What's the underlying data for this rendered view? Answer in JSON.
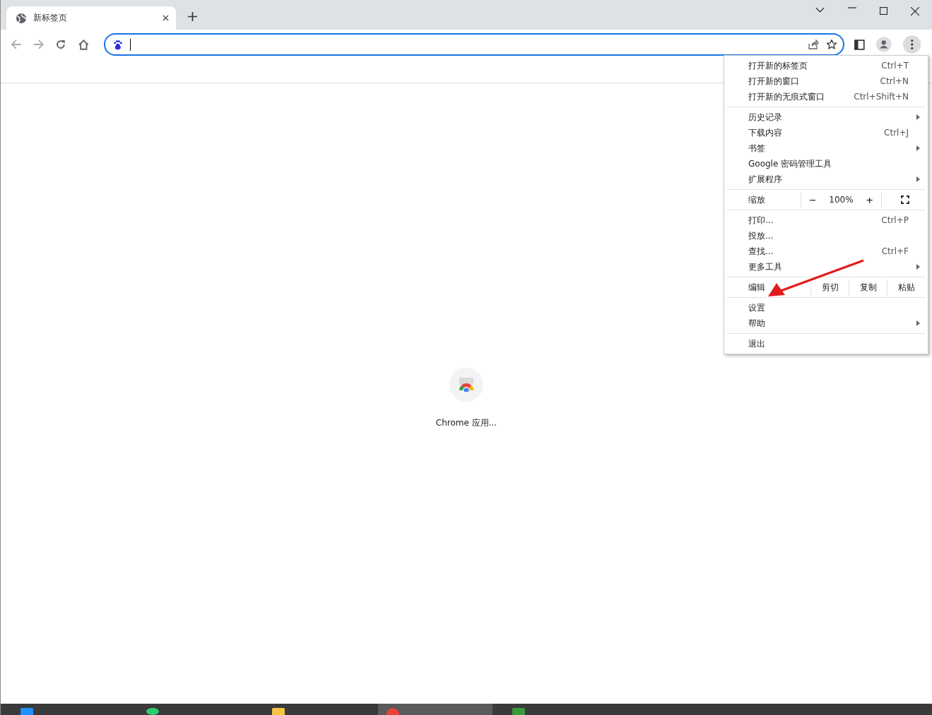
{
  "tabs": [
    {
      "title": "新标签页",
      "selected": true
    }
  ],
  "menu": {
    "items": [
      {
        "kind": "item",
        "label": "打开新的标签页",
        "shortcut": "Ctrl+T",
        "submenu": false
      },
      {
        "kind": "item",
        "label": "打开新的窗口",
        "shortcut": "Ctrl+N",
        "submenu": false
      },
      {
        "kind": "item",
        "label": "打开新的无痕式窗口",
        "shortcut": "Ctrl+Shift+N",
        "submenu": false
      },
      {
        "kind": "separator"
      },
      {
        "kind": "item",
        "label": "历史记录",
        "submenu": true
      },
      {
        "kind": "item",
        "label": "下载内容",
        "shortcut": "Ctrl+J",
        "submenu": false
      },
      {
        "kind": "item",
        "label": "书签",
        "submenu": true
      },
      {
        "kind": "item",
        "label": "Google 密码管理工具",
        "submenu": false
      },
      {
        "kind": "item",
        "label": "扩展程序",
        "submenu": true
      },
      {
        "kind": "zoom",
        "label": "缩放",
        "minus": "−",
        "value": "100%",
        "plus": "+"
      },
      {
        "kind": "item",
        "label": "打印...",
        "shortcut": "Ctrl+P",
        "submenu": false
      },
      {
        "kind": "item",
        "label": "投放...",
        "submenu": false
      },
      {
        "kind": "item",
        "label": "查找...",
        "shortcut": "Ctrl+F",
        "submenu": false
      },
      {
        "kind": "item",
        "label": "更多工具",
        "submenu": true
      },
      {
        "kind": "edit",
        "label": "编辑",
        "buttons": [
          "剪切",
          "复制",
          "粘贴"
        ]
      },
      {
        "kind": "item",
        "label": "设置",
        "submenu": false
      },
      {
        "kind": "item",
        "label": "帮助",
        "submenu": true
      },
      {
        "kind": "separator"
      },
      {
        "kind": "item",
        "label": "退出",
        "submenu": false
      }
    ]
  },
  "shortcuts": [
    {
      "title": "Chrome 应用..."
    }
  ]
}
